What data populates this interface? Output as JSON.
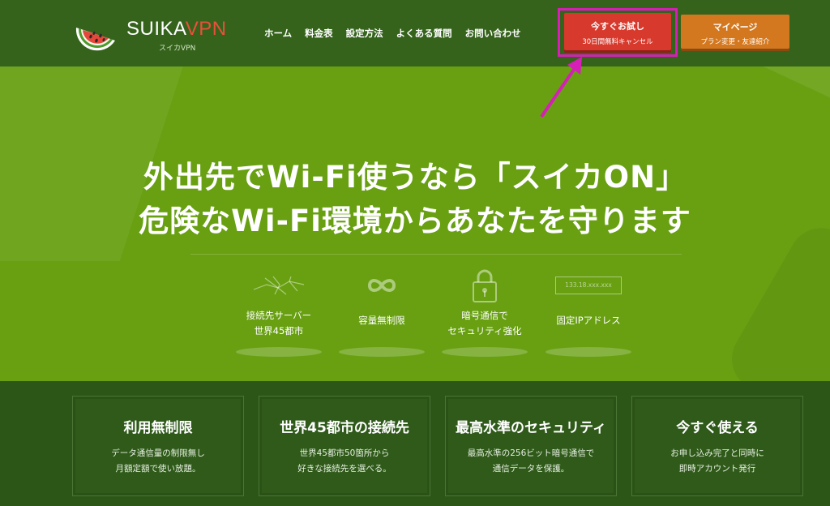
{
  "brand": {
    "name_main": "SUIKA",
    "name_accent": "VPN",
    "tagline": "スイカVPN"
  },
  "nav": [
    {
      "label": "ホーム"
    },
    {
      "label": "料金表"
    },
    {
      "label": "設定方法"
    },
    {
      "label": "よくある質問"
    },
    {
      "label": "お問い合わせ"
    }
  ],
  "cta_trial": {
    "line1": "今すぐお試し",
    "line2": "30日間無料キャンセル"
  },
  "cta_mypage": {
    "line1": "マイページ",
    "line2": "プラン変更・友達紹介"
  },
  "hero": {
    "line1": "外出先でWi-Fi使うなら「スイカON」",
    "line2": "危険なWi-Fi環境からあなたを守ります"
  },
  "features": [
    {
      "icon": "network-map-icon",
      "line1": "接続先サーバー",
      "line2": "世界45都市"
    },
    {
      "icon": "infinity-icon",
      "line1": "容量無制限",
      "line2": ""
    },
    {
      "icon": "lock-icon",
      "line1": "暗号通信で",
      "line2": "セキュリティ強化"
    },
    {
      "icon": "ip-address-box-icon",
      "ip_text": "133.18.xxx.xxx",
      "line1": "固定IPアドレス",
      "line2": ""
    }
  ],
  "cards": [
    {
      "title": "利用無制限",
      "line1": "データ通信量の制限無し",
      "line2": "月額定額で使い放題。"
    },
    {
      "title": "世界45都市の接続先",
      "line1": "世界45都市50箇所から",
      "line2": "好きな接続先を選べる。"
    },
    {
      "title": "最高水準のセキュリティ",
      "line1": "最高水準の256ビット暗号通信で",
      "line2": "通信データを保護。"
    },
    {
      "title": "今すぐ使える",
      "line1": "お申し込み完了と同時に",
      "line2": "即時アカウント発行"
    }
  ],
  "colors": {
    "header_bg": "#35631c",
    "hero_bg": "#68a012",
    "trial_button": "#d7392c",
    "mypage_button": "#d4781f",
    "highlight_frame": "#d61fb6"
  }
}
